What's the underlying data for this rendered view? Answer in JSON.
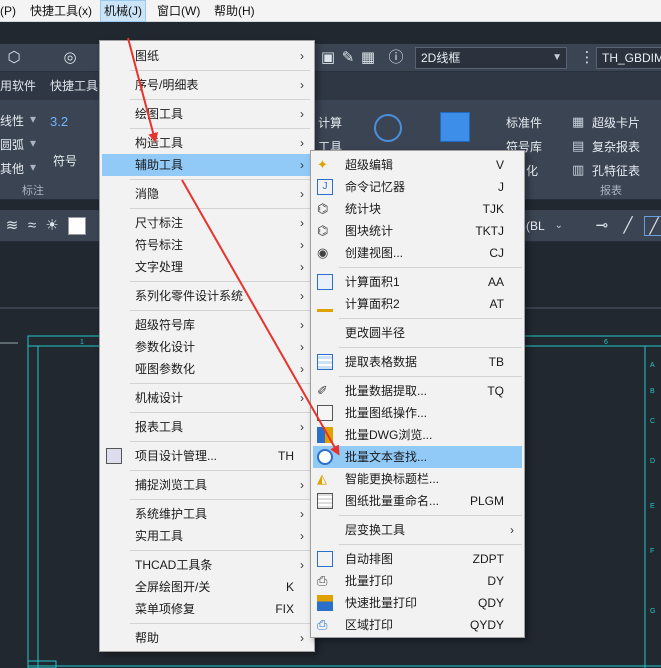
{
  "menubar": {
    "items": [
      "(P)",
      "快捷工具(x)",
      "机械(J)",
      "窗口(W)",
      "帮助(H)"
    ]
  },
  "toolbar": {
    "visual_style": "2D线框",
    "dropdown_right": "TH_GBDIM"
  },
  "tabs": [
    "用软件",
    "快捷工具"
  ],
  "ribbon": {
    "left_items": [
      "线性",
      "圆弧",
      "其他"
    ],
    "symbol_label": "符号",
    "group_annotation": "标注",
    "icon_value": "3.2",
    "calc_label": "计算",
    "tool_label": "工具",
    "std_label": "标准件",
    "symlib_label": "符号库",
    "digitize_label": "化",
    "super_card": "超级卡片",
    "complex_report": "复杂报表",
    "hole_table": "孔特征表",
    "group_report": "报表"
  },
  "toolbar2": {
    "layer_text": "层(BL"
  },
  "main_menu": {
    "items": [
      {
        "label": "图纸",
        "sub": "›"
      },
      {
        "label": "序号/明细表",
        "sub": "›"
      },
      {
        "label": "绘图工具",
        "sub": "›"
      },
      {
        "label": "构造工具",
        "sub": "›"
      },
      {
        "label": "辅助工具",
        "sub": "›"
      },
      {
        "label": "消隐",
        "sub": "›"
      },
      {
        "label": "尺寸标注",
        "sub": "›"
      },
      {
        "label": "符号标注",
        "sub": "›"
      },
      {
        "label": "文字处理",
        "sub": "›"
      },
      {
        "label": "系列化零件设计系统",
        "sub": "›"
      },
      {
        "label": "超级符号库",
        "sub": "›"
      },
      {
        "label": "参数化设计",
        "sub": "›"
      },
      {
        "label": "哑图参数化",
        "sub": "›"
      },
      {
        "label": "机械设计",
        "sub": "›"
      },
      {
        "label": "报表工具",
        "sub": "›"
      },
      {
        "label": "项目设计管理...",
        "shortcut": "TH"
      },
      {
        "label": "捕捉浏览工具",
        "sub": "›"
      },
      {
        "label": "系统维护工具",
        "sub": "›"
      },
      {
        "label": "实用工具",
        "sub": "›"
      },
      {
        "label": "THCAD工具条",
        "sub": "›"
      },
      {
        "label": "全屏绘图开/关",
        "shortcut": "K"
      },
      {
        "label": "菜单项修复",
        "shortcut": "FIX"
      },
      {
        "label": "帮助",
        "sub": "›"
      }
    ]
  },
  "sub_menu": {
    "items": [
      {
        "label": "超级编辑",
        "shortcut": "V"
      },
      {
        "label": "命令记忆器",
        "shortcut": "J"
      },
      {
        "label": "统计块",
        "shortcut": "TJK"
      },
      {
        "label": "图块统计",
        "shortcut": "TKTJ"
      },
      {
        "label": "创建视图...",
        "shortcut": "CJ"
      },
      {
        "label": "计算面积1",
        "shortcut": "AA"
      },
      {
        "label": "计算面积2",
        "shortcut": "AT"
      },
      {
        "label": "更改圆半径",
        "shortcut": ""
      },
      {
        "label": "提取表格数据",
        "shortcut": "TB"
      },
      {
        "label": "批量数据提取...",
        "shortcut": "TQ"
      },
      {
        "label": "批量图纸操作...",
        "shortcut": ""
      },
      {
        "label": "批量DWG浏览...",
        "shortcut": ""
      },
      {
        "label": "批量文本查找...",
        "shortcut": ""
      },
      {
        "label": "智能更换标题栏...",
        "shortcut": ""
      },
      {
        "label": "图纸批量重命名...",
        "shortcut": "PLGM"
      },
      {
        "label": "层变换工具",
        "sub": "›"
      },
      {
        "label": "自动排图",
        "shortcut": "ZDPT"
      },
      {
        "label": "批量打印",
        "shortcut": "DY"
      },
      {
        "label": "快速批量打印",
        "shortcut": "QDY"
      },
      {
        "label": "区域打印",
        "shortcut": "QYDY"
      }
    ]
  },
  "drawing": {
    "border_numbers": [
      "1",
      "6"
    ],
    "right_letters": [
      "A",
      "B",
      "C",
      "D",
      "E",
      "F",
      "G"
    ]
  },
  "colors": {
    "highlight": "#91c9f7",
    "arrow": "#e8322d",
    "frame": "#22c8c8"
  }
}
